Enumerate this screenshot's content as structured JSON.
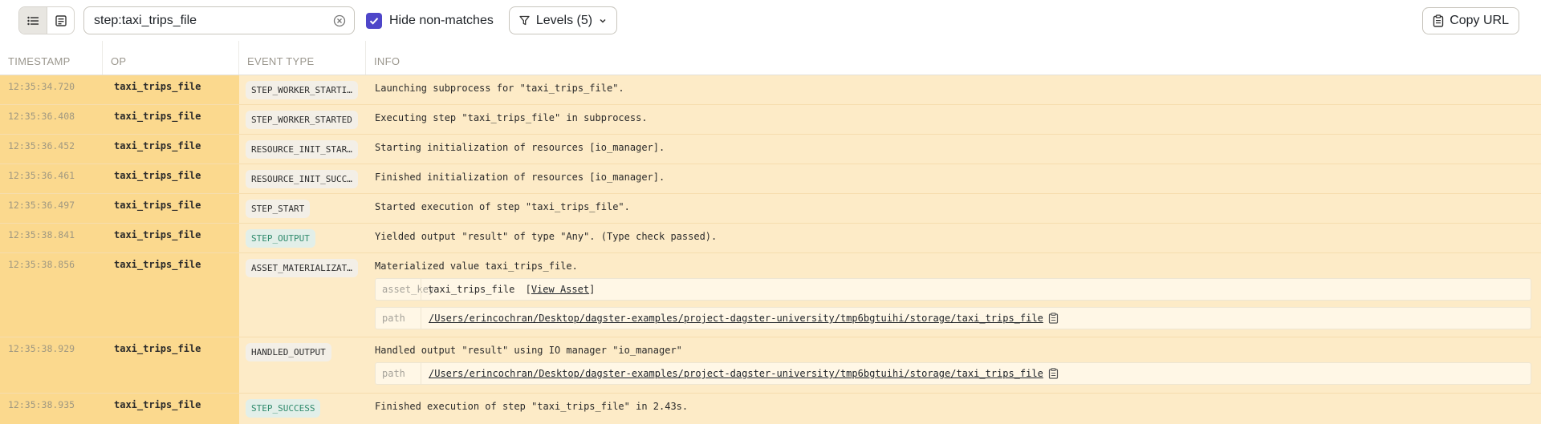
{
  "toolbar": {
    "search_value": "step:taxi_trips_file",
    "hide_non_matches_label": "Hide non-matches",
    "levels_label": "Levels (5)",
    "copy_url_label": "Copy URL"
  },
  "table": {
    "columns": [
      "TIMESTAMP",
      "OP",
      "EVENT TYPE",
      "INFO"
    ],
    "rows": [
      {
        "ts": "12:35:34.720",
        "op": "taxi_trips_file",
        "event": "STEP_WORKER_STARTI…",
        "info": "Launching subprocess for \"taxi_trips_file\"."
      },
      {
        "ts": "12:35:36.408",
        "op": "taxi_trips_file",
        "event": "STEP_WORKER_STARTED",
        "info": "Executing step \"taxi_trips_file\" in subprocess."
      },
      {
        "ts": "12:35:36.452",
        "op": "taxi_trips_file",
        "event": "RESOURCE_INIT_STAR…",
        "info": "Starting initialization of resources [io_manager]."
      },
      {
        "ts": "12:35:36.461",
        "op": "taxi_trips_file",
        "event": "RESOURCE_INIT_SUCC…",
        "info": "Finished initialization of resources [io_manager]."
      },
      {
        "ts": "12:35:36.497",
        "op": "taxi_trips_file",
        "event": "STEP_START",
        "info": "Started execution of step \"taxi_trips_file\"."
      },
      {
        "ts": "12:35:38.841",
        "op": "taxi_trips_file",
        "event": "STEP_OUTPUT",
        "info": "Yielded output \"result\" of type \"Any\". (Type check passed)."
      },
      {
        "ts": "12:35:38.856",
        "op": "taxi_trips_file",
        "event": "ASSET_MATERIALIZAT…",
        "info": "Materialized value taxi_trips_file.",
        "asset_key_label": "asset_key",
        "asset_key_value": "taxi_trips_file",
        "view_asset_label": "View Asset",
        "path_label": "path",
        "path_value": "/Users/erincochran/Desktop/dagster-examples/project-dagster-university/tmp6bgtuihi/storage/taxi_trips_file"
      },
      {
        "ts": "12:35:38.929",
        "op": "taxi_trips_file",
        "event": "HANDLED_OUTPUT",
        "info": "Handled output \"result\" using IO manager \"io_manager\"",
        "path_label": "path",
        "path_value": "/Users/erincochran/Desktop/dagster-examples/project-dagster-university/tmp6bgtuihi/storage/taxi_trips_file"
      },
      {
        "ts": "12:35:38.935",
        "op": "taxi_trips_file",
        "event": "STEP_SUCCESS",
        "info": "Finished execution of step \"taxi_trips_file\" in 2.43s."
      }
    ]
  },
  "colors": {
    "accent": "#4e46c9",
    "row_highlight": "#fdebc7",
    "ts_op_highlight": "#fbd98e",
    "success_tag": "#2f8a6c"
  }
}
